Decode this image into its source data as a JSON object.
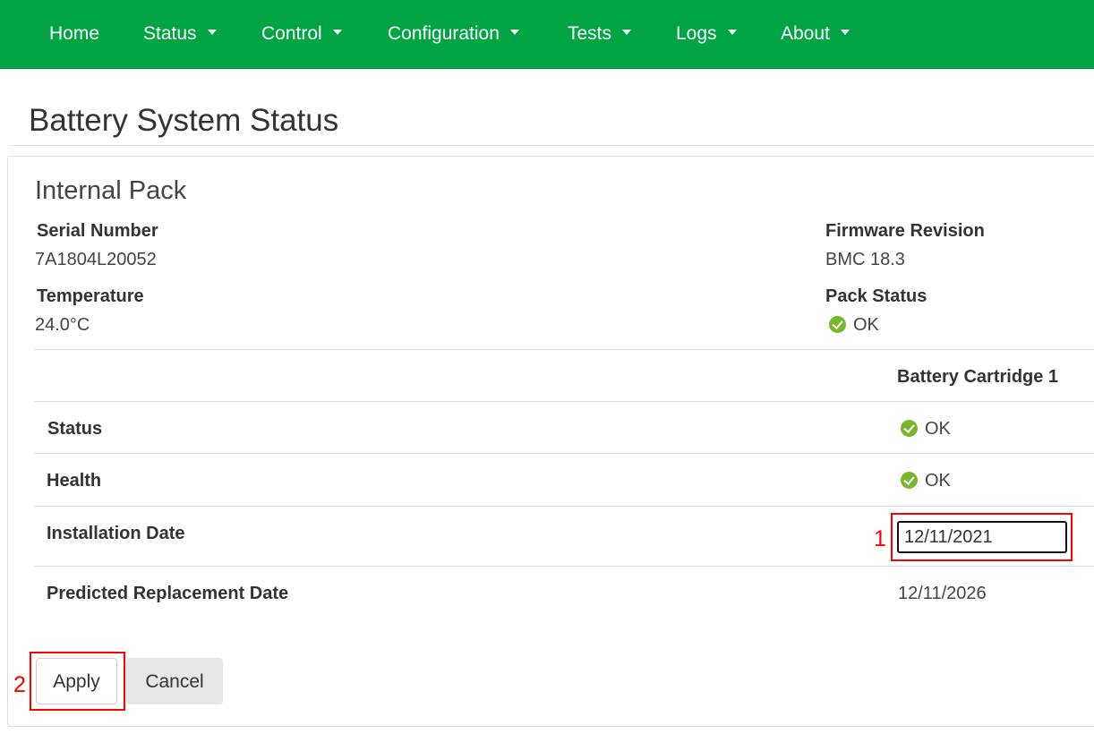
{
  "nav": {
    "home": "Home",
    "status": "Status",
    "control": "Control",
    "configuration": "Configuration",
    "tests": "Tests",
    "logs": "Logs",
    "about": "About"
  },
  "page": {
    "title": "Battery System Status",
    "section_title": "Internal Pack"
  },
  "pack": {
    "serial_label": "Serial Number",
    "serial_value": "7A1804L20052",
    "firmware_label": "Firmware Revision",
    "firmware_value": "BMC 18.3",
    "temperature_label": "Temperature",
    "temperature_value": "24.0°C",
    "pack_status_label": "Pack Status",
    "pack_status_value": "OK"
  },
  "cartridge_table": {
    "column_header": "Battery Cartridge  1",
    "rows": [
      {
        "label": "Status",
        "value": "OK",
        "icon": "check-circle-icon"
      },
      {
        "label": "Health",
        "value": "OK",
        "icon": "check-circle-icon"
      },
      {
        "label": "Installation Date",
        "value": "12/11/2021"
      },
      {
        "label": "Predicted Replacement Date",
        "value": "12/11/2026"
      }
    ]
  },
  "buttons": {
    "apply": "Apply",
    "cancel": "Cancel"
  },
  "annotations": {
    "one": "1",
    "two": "2"
  },
  "colors": {
    "navbar": "#00a443",
    "ok_icon": "#76b82a",
    "annotation": "#ff0000"
  }
}
